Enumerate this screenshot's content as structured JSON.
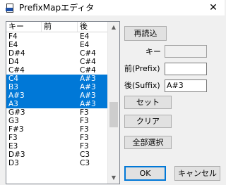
{
  "window": {
    "title": "PrefixMapエディタ",
    "close_glyph": "✕"
  },
  "list": {
    "columns": [
      "キー",
      "前",
      "後"
    ],
    "rows": [
      {
        "key": "F4",
        "before": "",
        "after": "E4",
        "selected": false
      },
      {
        "key": "E4",
        "before": "",
        "after": "E4",
        "selected": false
      },
      {
        "key": "D#4",
        "before": "",
        "after": "C#4",
        "selected": false
      },
      {
        "key": "D4",
        "before": "",
        "after": "C#4",
        "selected": false
      },
      {
        "key": "C#4",
        "before": "",
        "after": "C#4",
        "selected": false
      },
      {
        "key": "C4",
        "before": "",
        "after": "A#3",
        "selected": true
      },
      {
        "key": "B3",
        "before": "",
        "after": "A#3",
        "selected": true
      },
      {
        "key": "A#3",
        "before": "",
        "after": "A#3",
        "selected": true
      },
      {
        "key": "A3",
        "before": "",
        "after": "A#3",
        "selected": true
      },
      {
        "key": "G#3",
        "before": "",
        "after": "F3",
        "selected": false
      },
      {
        "key": "G3",
        "before": "",
        "after": "F3",
        "selected": false
      },
      {
        "key": "F#3",
        "before": "",
        "after": "F3",
        "selected": false
      },
      {
        "key": "F3",
        "before": "",
        "after": "F3",
        "selected": false
      },
      {
        "key": "E3",
        "before": "",
        "after": "F3",
        "selected": false
      },
      {
        "key": "D#3",
        "before": "",
        "after": "C3",
        "selected": false
      },
      {
        "key": "D3",
        "before": "",
        "after": "C3",
        "selected": false
      }
    ]
  },
  "form": {
    "reload_label": "再読込",
    "key_label": "キー",
    "key_value": "",
    "prefix_label": "前(Prefix)",
    "prefix_value": "",
    "suffix_label": "後(Suffix)",
    "suffix_value": "A#3",
    "set_label": "セット",
    "clear_label": "クリア",
    "select_all_label": "全部選択",
    "ok_label": "OK",
    "cancel_label": "キャンセル"
  },
  "colors": {
    "selection": "#0078d7",
    "focus_border": "#0078d7"
  }
}
